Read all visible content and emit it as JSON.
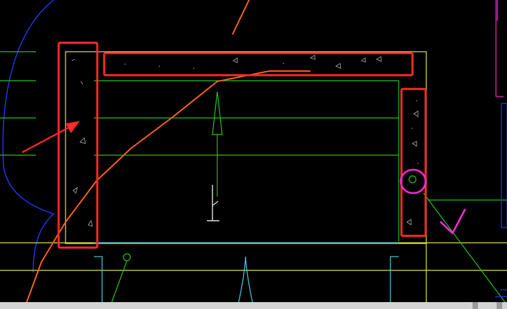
{
  "drawing": {
    "title": "",
    "colors": {
      "background": "#000000",
      "wall_outline": "#e8e84a",
      "slab_lines": "#22c822",
      "beam_line": "#3cc8d8",
      "annotation_red": "#ff2a2a",
      "annotation_magenta": "#ff2adc",
      "rebar_orange": "#ff6418",
      "arc_blue": "#1e3cff",
      "symbol_white": "#e6e6e6",
      "dot_grey": "#b4b4b4"
    },
    "annotations": {
      "highlight_boxes": [
        "left-column",
        "top-beam",
        "right-column"
      ],
      "arrow": "pointing-to-left-column",
      "circle_marker": "magenta-circle",
      "check_mark": "magenta-check"
    },
    "icons": {
      "section_marker": "section-mark-icon",
      "grid_bubble": "grid-bubble-icon",
      "north_arrow": "up-arrow-icon",
      "check": "check-icon"
    }
  },
  "statusbar": {
    "visible": true
  }
}
